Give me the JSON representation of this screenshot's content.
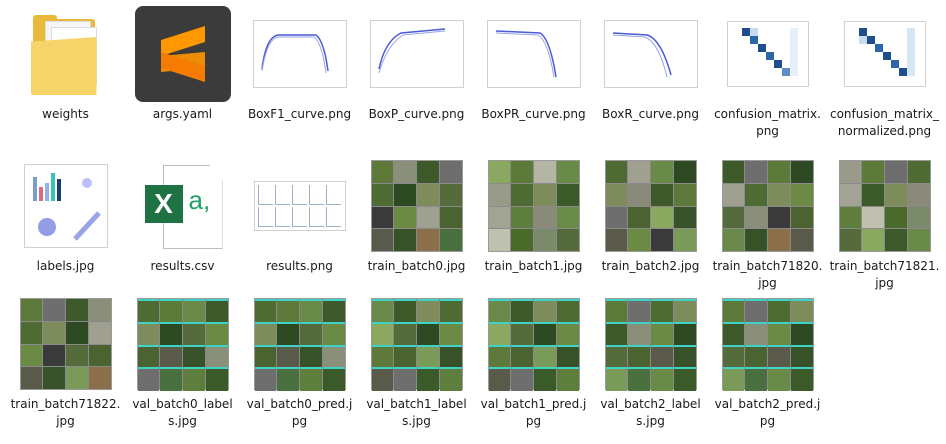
{
  "files": [
    {
      "label": "weights",
      "kind": "folder",
      "icon": "folder-icon"
    },
    {
      "label": "args.yaml",
      "kind": "sublime",
      "icon": "sublime-text-icon"
    },
    {
      "label": "BoxF1_curve.png",
      "kind": "plot",
      "icon": "curve-thumbnail"
    },
    {
      "label": "BoxP_curve.png",
      "kind": "plot",
      "icon": "curve-thumbnail"
    },
    {
      "label": "BoxPR_curve.png",
      "kind": "plot",
      "icon": "curve-thumbnail"
    },
    {
      "label": "BoxR_curve.png",
      "kind": "plot",
      "icon": "curve-thumbnail"
    },
    {
      "label": "confusion_matrix.png",
      "kind": "matrix",
      "icon": "matrix-thumbnail"
    },
    {
      "label": "confusion_matrix_normalized.png",
      "kind": "matrix",
      "icon": "matrix-thumbnail"
    },
    {
      "label": "labels.jpg",
      "kind": "labels",
      "icon": "labels-thumbnail"
    },
    {
      "label": "results.csv",
      "kind": "excel",
      "icon": "excel-icon"
    },
    {
      "label": "results.png",
      "kind": "results",
      "icon": "results-thumbnail"
    },
    {
      "label": "train_batch0.jpg",
      "kind": "mosaic",
      "icon": "image-thumbnail"
    },
    {
      "label": "train_batch1.jpg",
      "kind": "mosaic",
      "icon": "image-thumbnail"
    },
    {
      "label": "train_batch2.jpg",
      "kind": "mosaic",
      "icon": "image-thumbnail"
    },
    {
      "label": "train_batch71820.jpg",
      "kind": "mosaic",
      "icon": "image-thumbnail"
    },
    {
      "label": "train_batch71821.jpg",
      "kind": "mosaic",
      "icon": "image-thumbnail"
    },
    {
      "label": "train_batch71822.jpg",
      "kind": "mosaic",
      "icon": "image-thumbnail"
    },
    {
      "label": "val_batch0_labels.jpg",
      "kind": "val",
      "icon": "image-thumbnail"
    },
    {
      "label": "val_batch0_pred.jpg",
      "kind": "val",
      "icon": "image-thumbnail"
    },
    {
      "label": "val_batch1_labels.jpg",
      "kind": "val",
      "icon": "image-thumbnail"
    },
    {
      "label": "val_batch1_pred.jpg",
      "kind": "val",
      "icon": "image-thumbnail"
    },
    {
      "label": "val_batch2_labels.jpg",
      "kind": "val",
      "icon": "image-thumbnail"
    },
    {
      "label": "val_batch2_pred.jpg",
      "kind": "val",
      "icon": "image-thumbnail"
    }
  ],
  "colors": {
    "folder": "#e8b93a",
    "sublime_bg": "#3b3b3b",
    "sublime_accent": "#ff9800",
    "excel": "#1f7244",
    "val_box": "#3fd2c7"
  }
}
